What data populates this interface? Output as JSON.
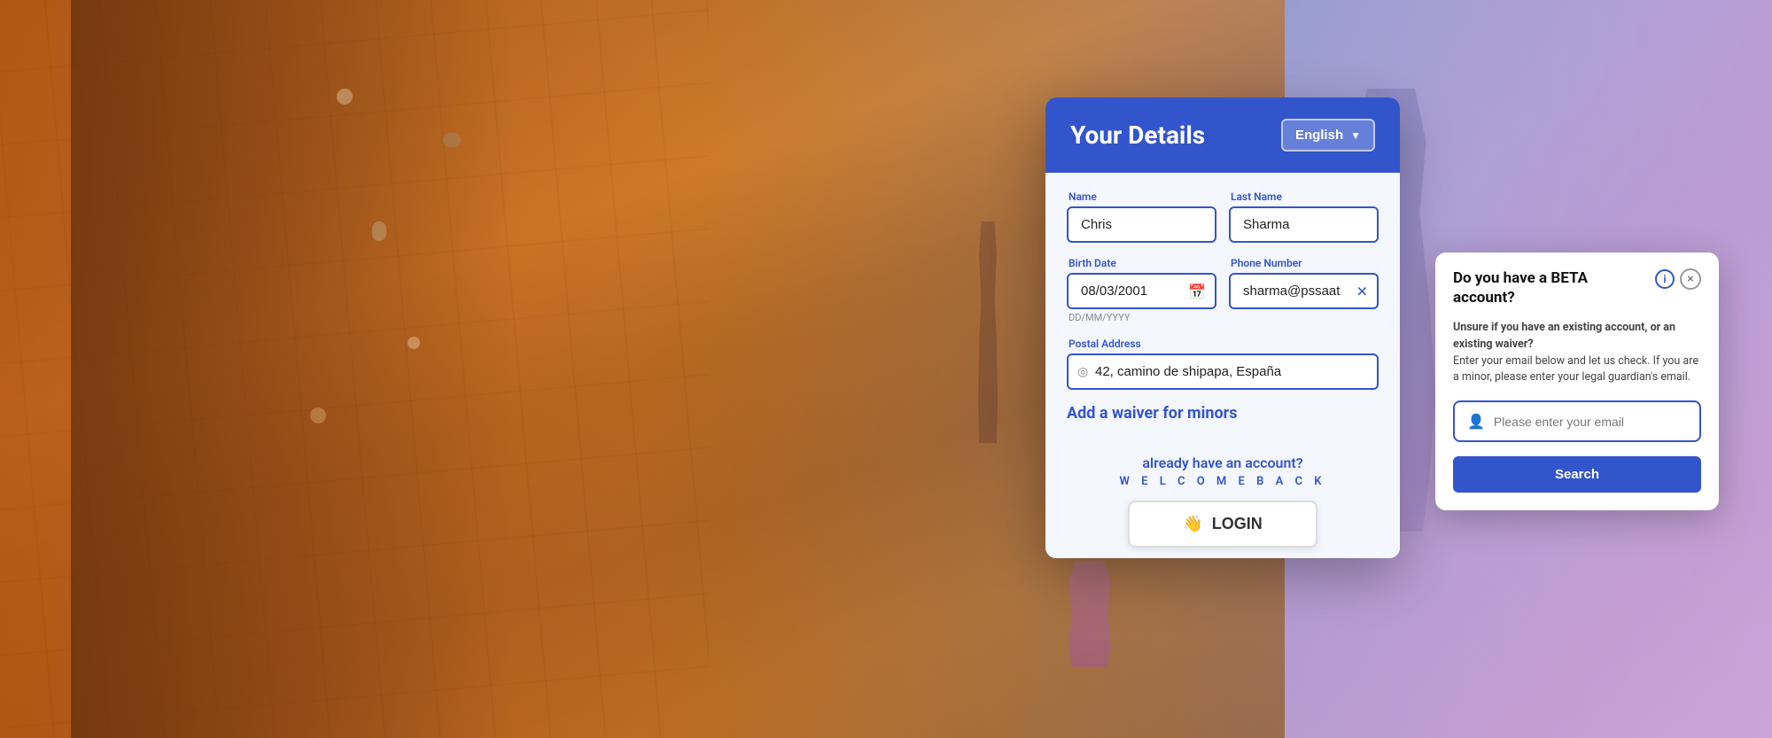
{
  "background": {
    "left_color_start": "#c8651a",
    "left_color_end": "#b05020",
    "right_color_start": "#9bb5d4",
    "right_color_end": "#e8b8d8"
  },
  "panel": {
    "title": "Your Details",
    "lang_selector": {
      "label": "English",
      "icon": "chevron-down"
    },
    "form": {
      "name_label": "Name",
      "name_value": "Chris",
      "last_name_label": "Last Name",
      "last_name_value": "Sharma",
      "birth_date_label": "Birth Date",
      "birth_date_value": "08/03/2001",
      "birth_date_hint": "DD/MM/YYYY",
      "phone_label": "Phone Number",
      "phone_value": "sharma@pssaat.com",
      "postal_label": "Postal Address",
      "postal_value": "42, camino de shipapa, España",
      "add_waiver_label": "Add a waiver for minors"
    },
    "already_account": {
      "text": "already have an account?",
      "welcome": "W E L C O M E   B A C K",
      "login_emoji": "👋",
      "login_label": "LOGIN"
    }
  },
  "beta_modal": {
    "title": "Do you have a BETA account?",
    "description_bold": "Unsure if you have an existing account, or an existing waiver?",
    "description": "Enter your email below and let us check. If you are a minor, please enter your legal guardian's email.",
    "email_placeholder": "Please enter your email",
    "search_button": "Search",
    "close_icon": "×",
    "info_icon": "i"
  }
}
